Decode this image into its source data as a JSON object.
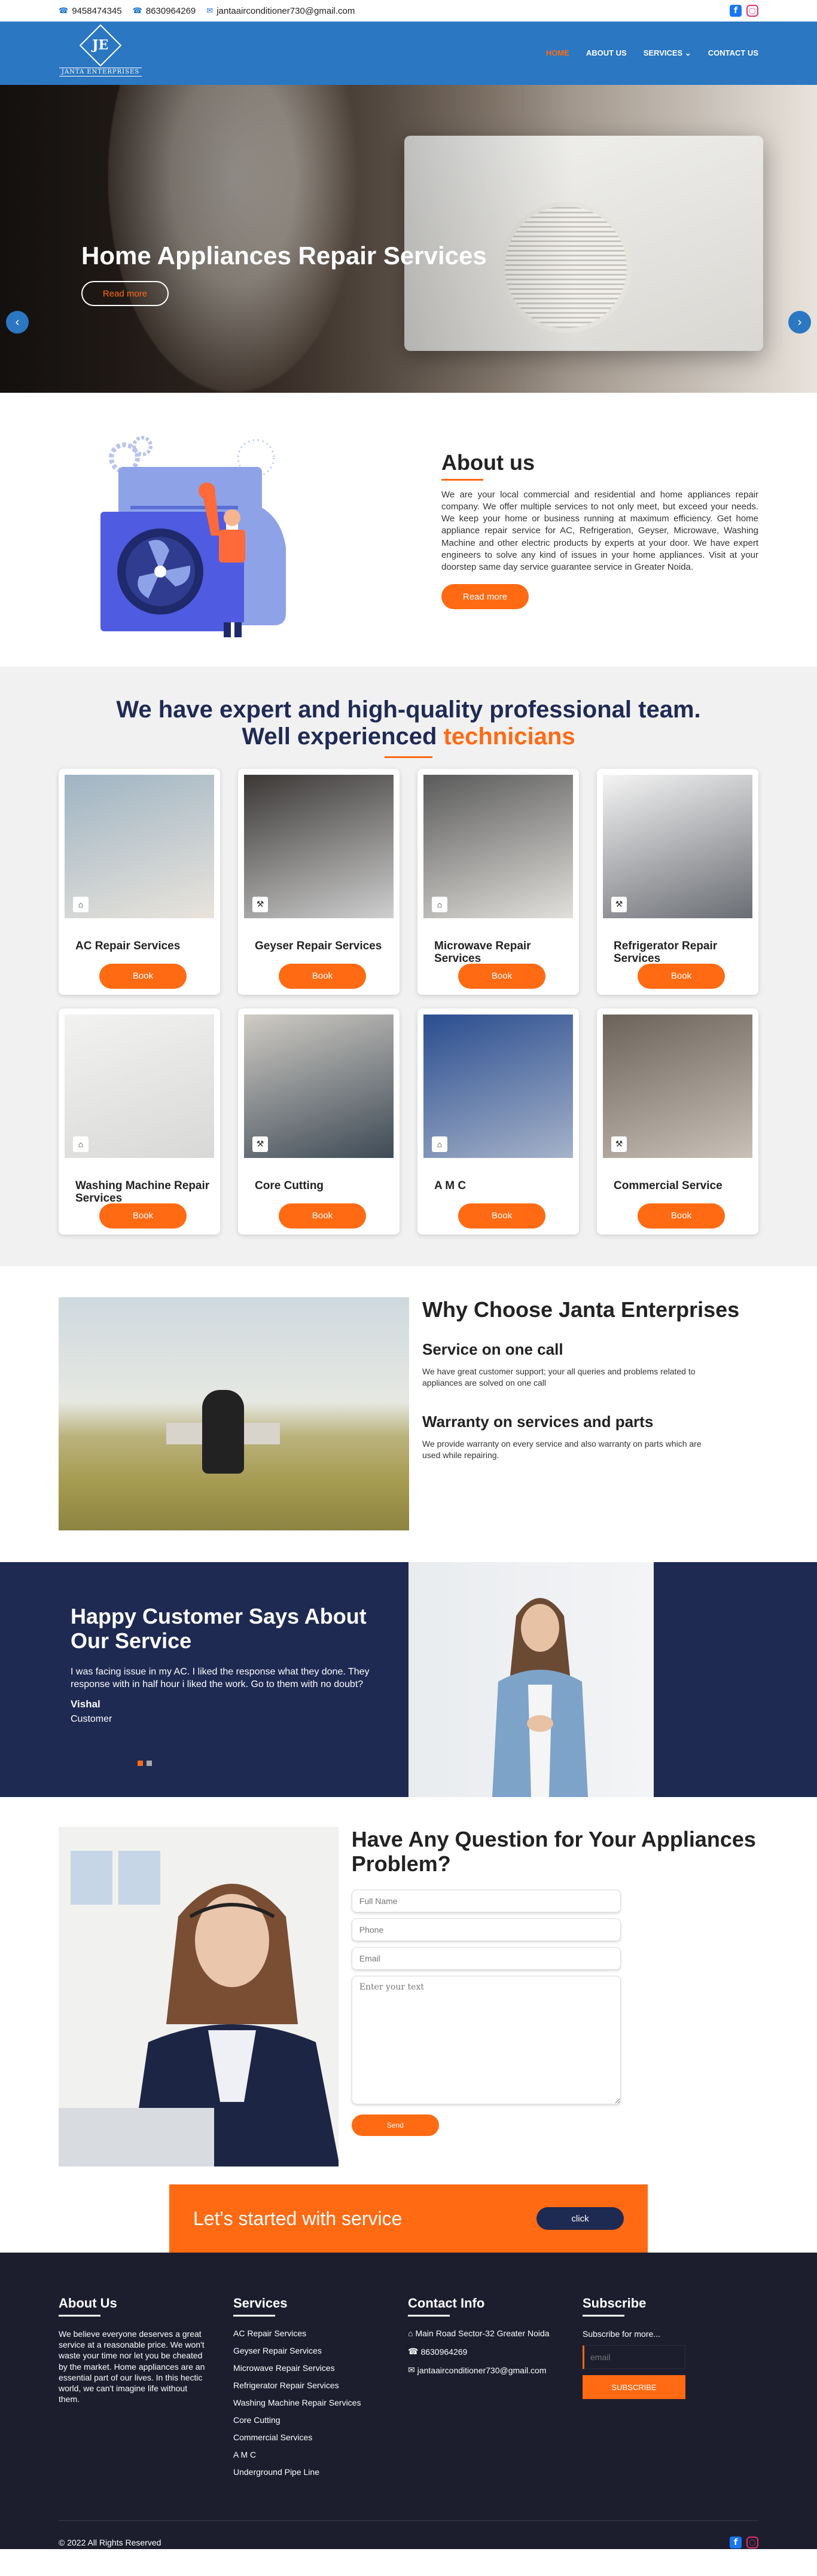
{
  "topbar": {
    "phone1": "9458474345",
    "phone2": "8630964269",
    "email": "jantaairconditioner730@gmail.com"
  },
  "logo": {
    "mark": "JE",
    "text": "JANTA ENTERPRISES"
  },
  "nav": {
    "items": [
      {
        "label": "HOME",
        "active": true
      },
      {
        "label": "ABOUT US",
        "active": false
      },
      {
        "label": "SERVICES ⌄",
        "active": false
      },
      {
        "label": "CONTACT US",
        "active": false
      }
    ]
  },
  "hero": {
    "title": "Home Appliances Repair Services",
    "button": "Read more"
  },
  "about": {
    "title": "About us",
    "body": "We are your local commercial and residential and home appliances repair company. We offer multiple services to not only meet, but exceed your needs. We keep your home or business running at maximum efficiency. Get home appliance repair service for AC, Refrigeration, Geyser, Microwave, Washing Machine and other electric products by experts at your door. We have expert engineers to solve any kind of issues in your home appliances. Visit at your doorstep same day service guarantee service in Greater Noida.",
    "button": "Read more"
  },
  "services": {
    "title_line1": "We have expert and high-quality professional team.",
    "title_line2_a": "Well experienced ",
    "title_line2_b": "technicians",
    "cards": [
      {
        "name": "AC Repair Services",
        "button": "Book",
        "colors": [
          "#9fb4c3",
          "#e9e4dc"
        ]
      },
      {
        "name": "Geyser Repair Services",
        "button": "Book",
        "colors": [
          "#3a3735",
          "#cfcfcf"
        ]
      },
      {
        "name": "Microwave Repair Services",
        "button": "Book",
        "colors": [
          "#5a5a5a",
          "#e2e0dc"
        ]
      },
      {
        "name": "Refrigerator Repair Services",
        "button": "Book",
        "colors": [
          "#f4f4f4",
          "#6a6d73"
        ]
      },
      {
        "name": "Washing Machine Repair Services",
        "button": "Book",
        "colors": [
          "#f2f2f0",
          "#d8d8d6"
        ]
      },
      {
        "name": "Core Cutting",
        "button": "Book",
        "colors": [
          "#d0ccc5",
          "#3e4a56"
        ]
      },
      {
        "name": "A M C",
        "button": "Book",
        "colors": [
          "#2a4d8f",
          "#a5b2c9"
        ]
      },
      {
        "name": "Commercial Service",
        "button": "Book",
        "colors": [
          "#6b625a",
          "#c9c1b8"
        ]
      }
    ]
  },
  "why": {
    "title": "Why Choose Janta Enterprises",
    "items": [
      {
        "title": "Service on one call",
        "text": "We have great customer support; your all queries and problems related to appliances are solved on one call"
      },
      {
        "title": "Warranty on services and parts",
        "text": "We provide warranty on every service and also warranty on parts which are used while repairing."
      }
    ]
  },
  "testimonial": {
    "title": "Happy Customer Says About Our Service",
    "quote": "I was facing issue in my AC. I liked the response what they done. They response with in half hour i liked the work. Go to them with no doubt?",
    "author": "Vishal",
    "role": "Customer"
  },
  "contact": {
    "title": "Have Any Question for Your Appliances Problem?",
    "fullname_placeholder": "Full Name",
    "phone_placeholder": "Phone",
    "email_placeholder": "Email",
    "message_placeholder": "Enter your text",
    "send": "Send"
  },
  "cta": {
    "title": "Let's started with service",
    "button": "click"
  },
  "footer": {
    "about_title": "About Us",
    "about_text": "We believe everyone deserves a great service at a reasonable price. We won't waste your time nor let you be cheated by the market. Home appliances are an essential part of our lives. In this hectic world, we can't imagine life without them.",
    "services_title": "Services",
    "services": [
      "AC Repair Services",
      "Geyser Repair Services",
      "Microwave Repair Services",
      "Refrigerator Repair Services",
      "Washing Machine Repair Services",
      "Core Cutting",
      "Commercial Services",
      "A M C",
      "Underground Pipe Line"
    ],
    "contact_title": "Contact Info",
    "address": "Main Road Sector-32 Greater Noida",
    "phone": "8630964269",
    "email": "jantaairconditioner730@gmail.com",
    "subscribe_title": "Subscribe",
    "subscribe_text": "Subscribe for more...",
    "subscribe_placeholder": "email",
    "subscribe_button": "SUBSCRIBE",
    "copyright": "© 2022 All Rights Reserved"
  }
}
